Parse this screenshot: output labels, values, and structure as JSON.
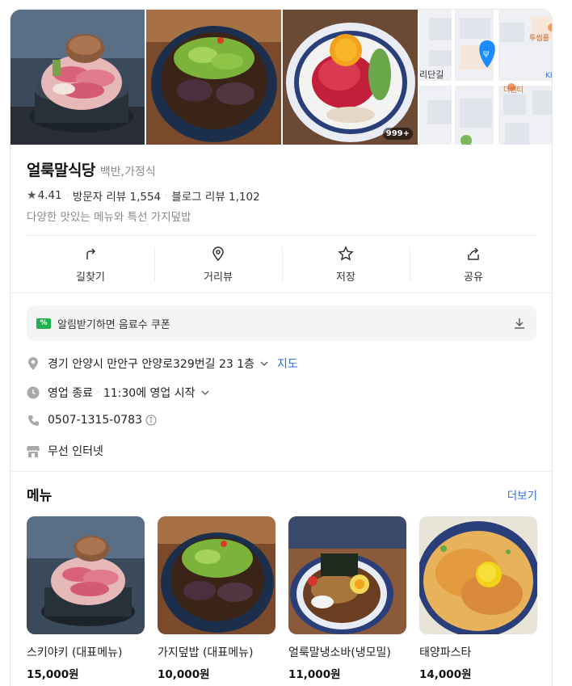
{
  "photos": {
    "count_badge": "999+",
    "map": {
      "street_label": "리단길",
      "poi_top": "투썸플",
      "poi_mid": "더벤티",
      "corner_label": "KI"
    }
  },
  "place": {
    "name": "얼룩말식당",
    "category": "백반,가정식",
    "rating": "4.41",
    "visitor_reviews": "방문자 리뷰 1,554",
    "blog_reviews": "블로그 리뷰 1,102",
    "description": "다양한 맛있는 메뉴와 특선 가지덮밥"
  },
  "actions": [
    {
      "label": "길찾기",
      "icon": "directions-icon"
    },
    {
      "label": "거리뷰",
      "icon": "streetview-icon"
    },
    {
      "label": "저장",
      "icon": "star-icon"
    },
    {
      "label": "공유",
      "icon": "share-icon"
    }
  ],
  "coupon": {
    "icon_text": "%",
    "text": "알림받기하면 음료수 쿠폰"
  },
  "info": {
    "address": "경기 안양시 만안구 안양로329번길 23 1층",
    "map_link": "지도",
    "status": "영업 종료",
    "hours": "11:30에 영업 시작",
    "phone": "0507-1315-0783",
    "amenity": "무선 인터넷"
  },
  "menu": {
    "title": "메뉴",
    "more": "더보기",
    "items": [
      {
        "name": "스키야키 (대표메뉴)",
        "price": "15,000원"
      },
      {
        "name": "가지덮밥 (대표메뉴)",
        "price": "10,000원"
      },
      {
        "name": "얼룩말냉소바(냉모밀)",
        "price": "11,000원"
      },
      {
        "name": "태양파스타",
        "price": "14,000원"
      }
    ]
  },
  "colors": {
    "link": "#2b6fd8",
    "map_pin": "#1a8cff",
    "coupon_green": "#1fb14c"
  }
}
